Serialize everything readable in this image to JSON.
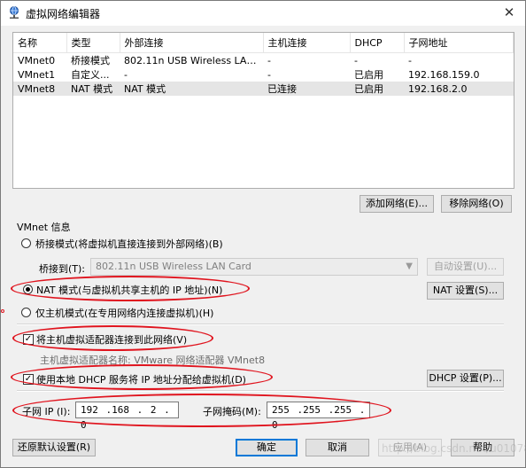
{
  "window": {
    "title": "虚拟网络编辑器",
    "close_glyph": "✕"
  },
  "networks": {
    "headers": [
      "名称",
      "类型",
      "外部连接",
      "主机连接",
      "DHCP",
      "子网地址"
    ],
    "rows": [
      [
        "VMnet0",
        "桥接模式",
        "802.11n USB Wireless LAN ...",
        "-",
        "-",
        "-"
      ],
      [
        "VMnet1",
        "自定义...",
        "-",
        "-",
        "已启用",
        "192.168.159.0"
      ],
      [
        "VMnet8",
        "NAT 模式",
        "NAT 模式",
        "已连接",
        "已启用",
        "192.168.2.0"
      ]
    ],
    "selected_row": 2
  },
  "actions": {
    "add_network": "添加网络(E)...",
    "remove_network": "移除网络(O)"
  },
  "vmnet_info": {
    "group_label": "VMnet 信息",
    "bridged_radio": "桥接模式(将虚拟机直接连接到外部网络)(B)",
    "bridged_to_label": "桥接到(T):",
    "bridged_to_value": "802.11n USB Wireless LAN Card",
    "auto_settings": "自动设置(U)...",
    "nat_radio": "NAT 模式(与虚拟机共享主机的 IP 地址)(N)",
    "nat_settings": "NAT 设置(S)...",
    "host_only_radio": "仅主机模式(在专用网络内连接虚拟机)(H)",
    "selected_mode": "nat",
    "connect_adapter_check": "将主机虚拟适配器连接到此网络(V)",
    "connect_adapter_checked": true,
    "adapter_name_text": "主机虚拟适配器名称: VMware 网络适配器 VMnet8",
    "dhcp_check": "使用本地 DHCP 服务将 IP 地址分配给虚拟机(D)",
    "dhcp_checked": true,
    "dhcp_settings": "DHCP 设置(P)...",
    "subnet_ip_label": "子网 IP (I):",
    "subnet_ip": "192 .168 . 2  . 0",
    "subnet_mask_label": "子网掩码(M):",
    "subnet_mask": "255 .255 .255 . 0"
  },
  "footer": {
    "restore_defaults": "还原默认设置(R)",
    "ok": "确定",
    "cancel": "取消",
    "apply": "应用(A)",
    "help": "帮助"
  },
  "watermark": "http://blog.csdn.net/u010780886",
  "annotation_color": "#e0141e"
}
